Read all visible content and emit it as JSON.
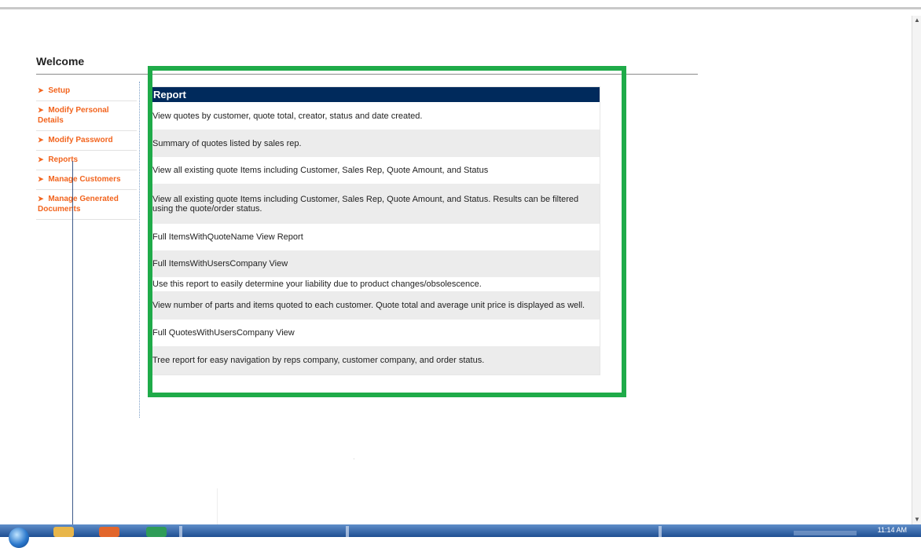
{
  "welcome_title": "Welcome",
  "sidebar": {
    "items": [
      {
        "label": "Setup"
      },
      {
        "label": "Modify Personal Details"
      },
      {
        "label": "Modify Password"
      },
      {
        "label": "Reports"
      },
      {
        "label": "Manage Customers"
      },
      {
        "label": "Manage Generated Documents"
      }
    ]
  },
  "report": {
    "header": "Report",
    "rows": [
      {
        "text": "View quotes by customer, quote total, creator, status and date created."
      },
      {
        "text": "Summary of quotes listed by sales rep."
      },
      {
        "text": "View all existing quote Items including Customer, Sales Rep, Quote Amount, and Status"
      },
      {
        "text": "View all existing quote Items including Customer, Sales Rep, Quote Amount, and Status. Results can be filtered using the quote/order status."
      },
      {
        "text": "Full ItemsWithQuoteName View Report"
      },
      {
        "text": "Full ItemsWithUsersCompany View"
      },
      {
        "text": "Use this report to easily determine your liability due to product changes/obsolescence."
      },
      {
        "text": "View number of parts and items quoted to each customer. Quote total and average unit price is displayed as well."
      },
      {
        "text": "Full QuotesWithUsersCompany View"
      },
      {
        "text": "Tree report for easy navigation by reps company, customer company, and order status."
      }
    ]
  },
  "taskbar": {
    "clock": "11:14 AM"
  },
  "colors": {
    "nav_link": "#f2641e",
    "report_header_bg": "#002a5c",
    "highlight_border": "#1fab49"
  },
  "icons": [
    "start-orb-icon",
    "file-explorer-icon",
    "media-player-icon",
    "browser-icon"
  ]
}
